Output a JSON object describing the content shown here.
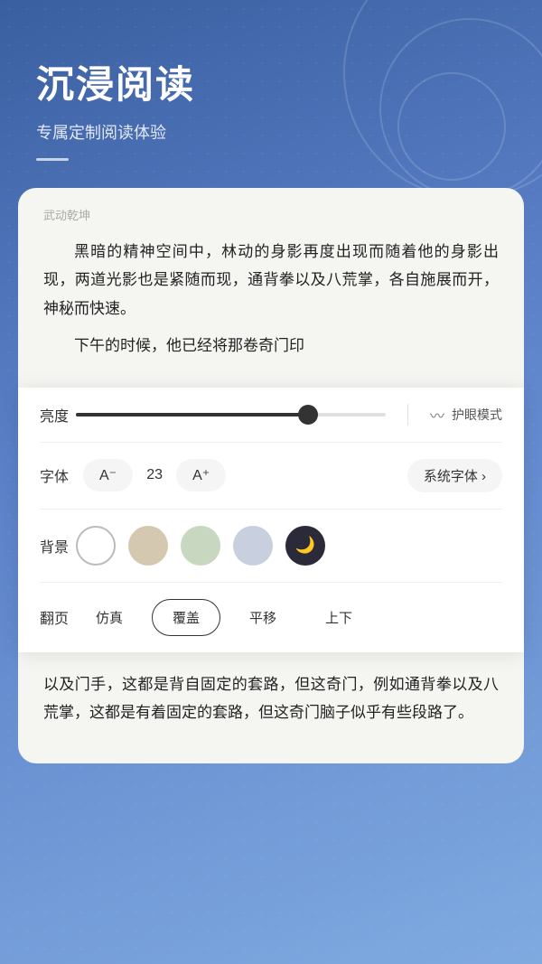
{
  "header": {
    "title": "沉浸阅读",
    "subtitle": "专属定制阅读体验"
  },
  "reading_card": {
    "book_title": "武动乾坤",
    "paragraphs": [
      "黑暗的精神空间中，林动的身影再度出现而随着他的身影出现，两道光影也是紧随而现，通背拳以及八荒掌，各自施展而开，神秘而快速。",
      "下午的时候，他已经将那卷奇门印"
    ]
  },
  "settings": {
    "brightness_label": "亮度",
    "brightness_value": 75,
    "eye_mode_label": "护眼模式",
    "font_label": "字体",
    "font_decrease": "A⁻",
    "font_size": "23",
    "font_increase": "A⁺",
    "font_family": "系统字体 ›",
    "bg_label": "背景",
    "backgrounds": [
      {
        "id": "white",
        "label": "白色",
        "selected": true
      },
      {
        "id": "beige",
        "label": "米色"
      },
      {
        "id": "green",
        "label": "绿色"
      },
      {
        "id": "blue",
        "label": "蓝色"
      },
      {
        "id": "dark",
        "label": "深色"
      }
    ],
    "pageturn_label": "翻页",
    "pageturn_options": [
      {
        "id": "simulation",
        "label": "仿真",
        "active": false
      },
      {
        "id": "cover",
        "label": "覆盖",
        "active": true
      },
      {
        "id": "slide",
        "label": "平移",
        "active": false
      },
      {
        "id": "updown",
        "label": "上下",
        "active": false
      }
    ]
  },
  "lower_card": {
    "paragraphs": [
      "以及门手，这都是背自固定的套路，但这奇门，例如通背拳以及八荒掌，这都是有着固定的套路，但这奇门脑子似乎有些段路了。"
    ]
  }
}
